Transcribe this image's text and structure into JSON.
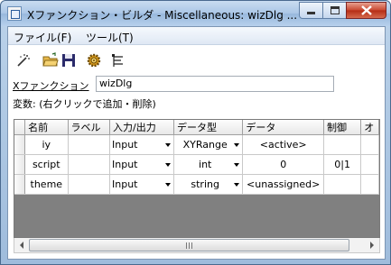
{
  "window": {
    "title": "Xファンクション・ビルダ - Miscellaneous: wizDlg ...",
    "controls": [
      "minimize-icon",
      "maximize-icon",
      "close-icon"
    ]
  },
  "menu": {
    "items": [
      {
        "label": "ファイル(F)"
      },
      {
        "label": "ツール(T)"
      }
    ]
  },
  "toolbar": {
    "icons": [
      "new-wand-icon",
      "open-folder-icon",
      "save-disk-icon",
      "gear-icon",
      "tree-view-icon"
    ]
  },
  "form": {
    "function_label": "Xファンクション",
    "function_value": "wizDlg",
    "variables_label": "変数: (右クリックで追加・削除)"
  },
  "grid": {
    "columns": [
      "名前",
      "ラベル",
      "入力/出力",
      "データ型",
      "データ",
      "制御",
      "オ"
    ],
    "rows": [
      {
        "name": "iy",
        "label": "",
        "io": "Input",
        "type": "XYRange",
        "data": "<active>",
        "control": ""
      },
      {
        "name": "script",
        "label": "",
        "io": "Input",
        "type": "int",
        "data": "0",
        "control": "0|1"
      },
      {
        "name": "theme",
        "label": "",
        "io": "Input",
        "type": "string",
        "data": "<unassigned>",
        "control": ""
      }
    ]
  },
  "colors": {
    "titlebar": "#aac6e6",
    "close_button": "#c8462e",
    "grid_empty": "#808080"
  }
}
